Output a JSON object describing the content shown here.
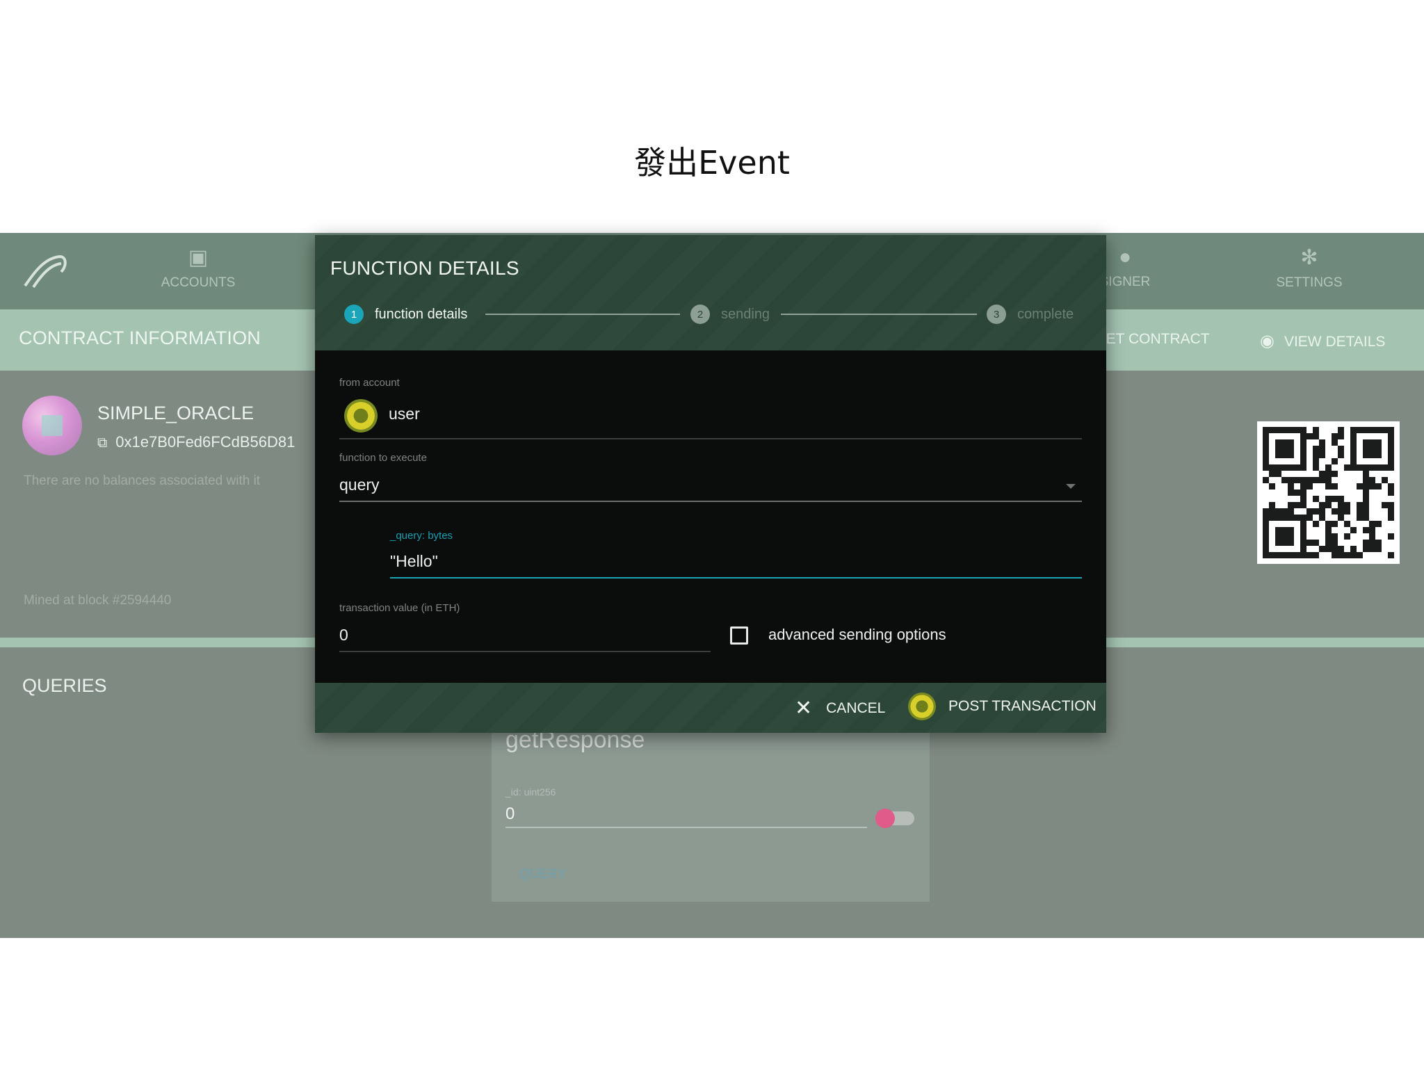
{
  "slide": {
    "title": "發出Event"
  },
  "app": {
    "nav": [
      {
        "label": "ACCOUNTS",
        "icon": "wallet-icon"
      },
      {
        "label": "SIGNER",
        "icon": "signer-icon"
      },
      {
        "label": "SETTINGS",
        "icon": "gear-icon"
      }
    ],
    "info_bar": {
      "title": "CONTRACT INFORMATION",
      "forget_label": "FORGET CONTRACT",
      "view_details_label": "VIEW DETAILS"
    },
    "contract": {
      "name": "SIMPLE_ORACLE",
      "address": "0x1e7B0Fed6FCdB56D81",
      "balances_note": "There are no balances associated with it",
      "mined_note": "Mined at block #2594440"
    },
    "queries": {
      "title": "QUERIES",
      "card": {
        "title": "getResponse",
        "input_label": "_id: uint256",
        "input_value": "0",
        "button_label": "QUERY"
      }
    }
  },
  "modal": {
    "title": "FUNCTION DETAILS",
    "steps": [
      {
        "num": "1",
        "label": "function details"
      },
      {
        "num": "2",
        "label": "sending"
      },
      {
        "num": "3",
        "label": "complete"
      }
    ],
    "from_account": {
      "label": "from account",
      "value": "user"
    },
    "function_to_execute": {
      "label": "function to execute",
      "value": "query"
    },
    "query_param": {
      "label": "_query: bytes",
      "value": "\"Hello\""
    },
    "transaction_value": {
      "label": "transaction value (in ETH)",
      "value": "0"
    },
    "advanced_options_label": "advanced sending options",
    "cancel_label": "CANCEL",
    "post_label": "POST TRANSACTION"
  },
  "colors": {
    "accent": "#1aa6b8",
    "modal_header": "#2f4a3b",
    "toggle_knob": "#e05a8a"
  }
}
